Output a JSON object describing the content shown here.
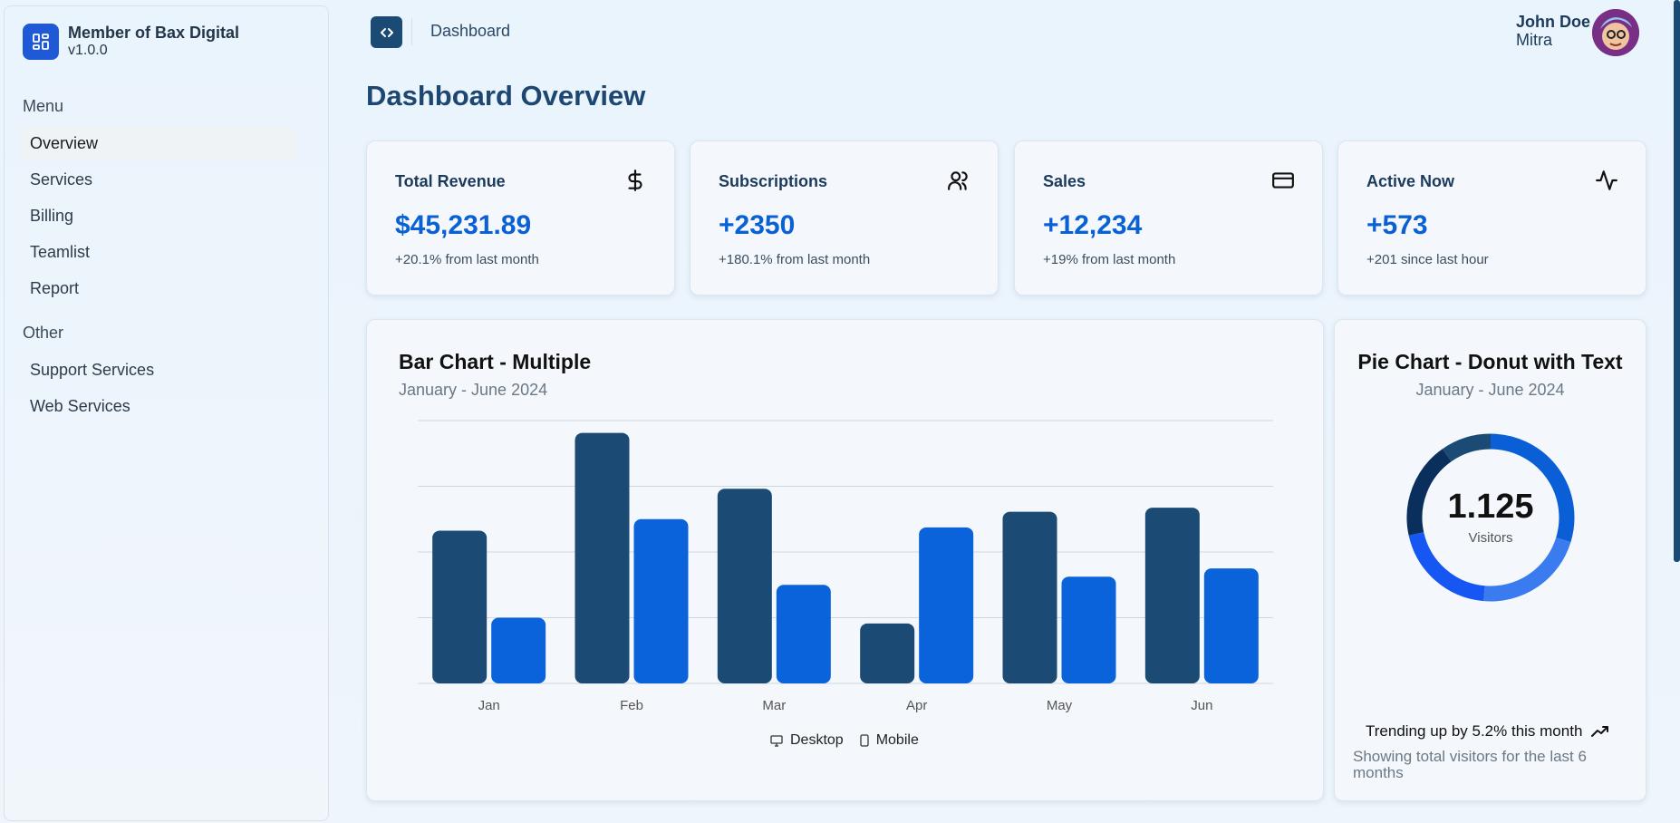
{
  "brand": {
    "name": "Member of Bax Digital",
    "version": "v1.0.0",
    "icon": "dashboard-grid-icon",
    "color": "#2059d6"
  },
  "sidebar": {
    "menu_label": "Menu",
    "menu_items": [
      {
        "label": "Overview",
        "active": true
      },
      {
        "label": "Services"
      },
      {
        "label": "Billing"
      },
      {
        "label": "Teamlist"
      },
      {
        "label": "Report"
      }
    ],
    "other_label": "Other",
    "other_items": [
      {
        "label": "Support Services"
      },
      {
        "label": "Web Services"
      }
    ]
  },
  "topbar": {
    "toggle_icon": "code-brackets-icon",
    "breadcrumb": "Dashboard"
  },
  "user": {
    "first": "John Doe",
    "last": "Mitra"
  },
  "page_title": "Dashboard Overview",
  "stats": [
    {
      "title": "Total Revenue",
      "value": "$45,231.89",
      "sub": "+20.1% from last month",
      "icon": "dollar-icon"
    },
    {
      "title": "Subscriptions",
      "value": "+2350",
      "sub": "+180.1% from last month",
      "icon": "users-icon"
    },
    {
      "title": "Sales",
      "value": "+12,234",
      "sub": "+19% from last month",
      "icon": "credit-card-icon"
    },
    {
      "title": "Active Now",
      "value": "+573",
      "sub": "+201 since last hour",
      "icon": "activity-icon"
    }
  ],
  "colors": {
    "accent": "#0a61d4",
    "dark": "#1b4a74",
    "desktop": "#1b4a74",
    "mobile": "#0a63db"
  },
  "bar_card": {
    "title": "Bar Chart - Multiple",
    "subtitle": "January - June 2024",
    "legend": [
      {
        "label": "Desktop",
        "icon": "monitor-icon"
      },
      {
        "label": "Mobile",
        "icon": "smartphone-icon"
      }
    ]
  },
  "pie_card": {
    "title": "Pie Chart - Donut with Text",
    "subtitle": "January - June 2024",
    "center_value": "1.125",
    "center_label": "Visitors",
    "trend": "Trending up by 5.2% this month",
    "trend_icon": "trending-up-icon",
    "footer": "Showing total visitors for the last 6 months"
  },
  "chart_data": [
    {
      "type": "bar",
      "categories": [
        "Jan",
        "Feb",
        "Mar",
        "Apr",
        "May",
        "Jun"
      ],
      "series": [
        {
          "name": "Desktop",
          "values": [
            186,
            305,
            237,
            73,
            209,
            214
          ]
        },
        {
          "name": "Mobile",
          "values": [
            80,
            200,
            120,
            190,
            130,
            140
          ]
        }
      ],
      "ylim": [
        0,
        320
      ],
      "grid": true,
      "legend": "bottom-center"
    },
    {
      "type": "pie",
      "donut": true,
      "values": [
        275,
        200,
        187,
        173,
        90
      ],
      "colors": [
        "#0a5fd6",
        "#3b7bf0",
        "#1656f2",
        "#0b2f5c",
        "#1b4a74"
      ]
    }
  ]
}
